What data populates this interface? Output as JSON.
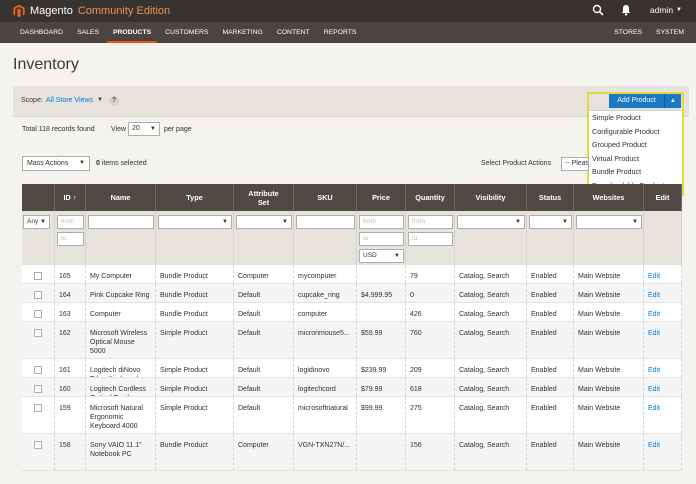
{
  "app": {
    "logo_text": "Magento",
    "edition": "Community Edition",
    "user": "admin"
  },
  "nav": {
    "left": [
      "DASHBOARD",
      "SALES",
      "PRODUCTS",
      "CUSTOMERS",
      "MARKETING",
      "CONTENT",
      "REPORTS"
    ],
    "right": [
      "STORES",
      "SYSTEM"
    ],
    "active": "PRODUCTS"
  },
  "page": {
    "title": "Inventory"
  },
  "scope": {
    "label": "Scope:",
    "value": "All Store Views",
    "help": "?"
  },
  "add_product": {
    "label": "Add Product",
    "options": [
      "Simple Product",
      "Configurable Product",
      "Grouped Product",
      "Virtual Product",
      "Bundle Product",
      "Downloadable Product"
    ]
  },
  "toolbar": {
    "records": "Total 118 records found",
    "view_label": "View",
    "per_page_value": "20",
    "per_page_label": "per page",
    "mass_actions": "Mass Actions",
    "selected_count": "0",
    "selected_text": "items selected",
    "select_product_actions": "Select Product Actions",
    "please_select": "-- Please Select --"
  },
  "grid": {
    "columns": [
      "",
      "ID",
      "Name",
      "Type",
      "Attribute Set",
      "SKU",
      "Price",
      "Quantity",
      "Visibility",
      "Status",
      "Websites",
      "Edit"
    ],
    "id_sort_icon": "arrow-up-icon",
    "filters": {
      "any": "Any",
      "from": "from",
      "to": "to",
      "currency": "USD"
    },
    "edit_label": "Edit",
    "rows": [
      {
        "id": "165",
        "name": "My Computer",
        "type": "Bundle Product",
        "set": "Computer",
        "sku": "mycomputer",
        "price": "",
        "qty": "79",
        "vis": "Catalog, Search",
        "status": "Enabled",
        "web": "Main Website"
      },
      {
        "id": "164",
        "name": "Pink Cupcake Ring",
        "type": "Bundle Product",
        "set": "Default",
        "sku": "cupcake_ring",
        "price": "$4,999.95",
        "qty": "0",
        "vis": "Catalog, Search",
        "status": "Enabled",
        "web": "Main Website"
      },
      {
        "id": "163",
        "name": "Computer",
        "type": "Bundle Product",
        "set": "Default",
        "sku": "computer",
        "price": "",
        "qty": "426",
        "vis": "Catalog, Search",
        "status": "Enabled",
        "web": "Main Website"
      },
      {
        "id": "162",
        "name": "Microsoft Wireless Optical Mouse 5000",
        "type": "Simple Product",
        "set": "Default",
        "sku": "micronmouse5...",
        "price": "$59.99",
        "qty": "760",
        "vis": "Catalog, Search",
        "status": "Enabled",
        "web": "Main Website"
      },
      {
        "id": "161",
        "name": "Logitech diNovo Edge Keyboard",
        "type": "Simple Product",
        "set": "Default",
        "sku": "logidinovo",
        "price": "$239.99",
        "qty": "209",
        "vis": "Catalog, Search",
        "status": "Enabled",
        "web": "Main Website"
      },
      {
        "id": "160",
        "name": "Logitech Cordless Optical Trackman",
        "type": "Simple Product",
        "set": "Default",
        "sku": "logitechcord",
        "price": "$79.99",
        "qty": "618",
        "vis": "Catalog, Search",
        "status": "Enabled",
        "web": "Main Website"
      },
      {
        "id": "159",
        "name": "Microsoft Natural Ergonomic Keyboard 4000",
        "type": "Simple Product",
        "set": "Default",
        "sku": "microsoftnatural",
        "price": "$99.99",
        "qty": "275",
        "vis": "Catalog, Search",
        "status": "Enabled",
        "web": "Main Website"
      },
      {
        "id": "158",
        "name": "Sony VAIO 11.1\" Notebook PC",
        "type": "Bundle Product",
        "set": "Computer",
        "sku": "VGN-TXN27N/...",
        "price": "",
        "qty": "156",
        "vis": "Catalog, Search",
        "status": "Enabled",
        "web": "Main Website"
      }
    ]
  }
}
